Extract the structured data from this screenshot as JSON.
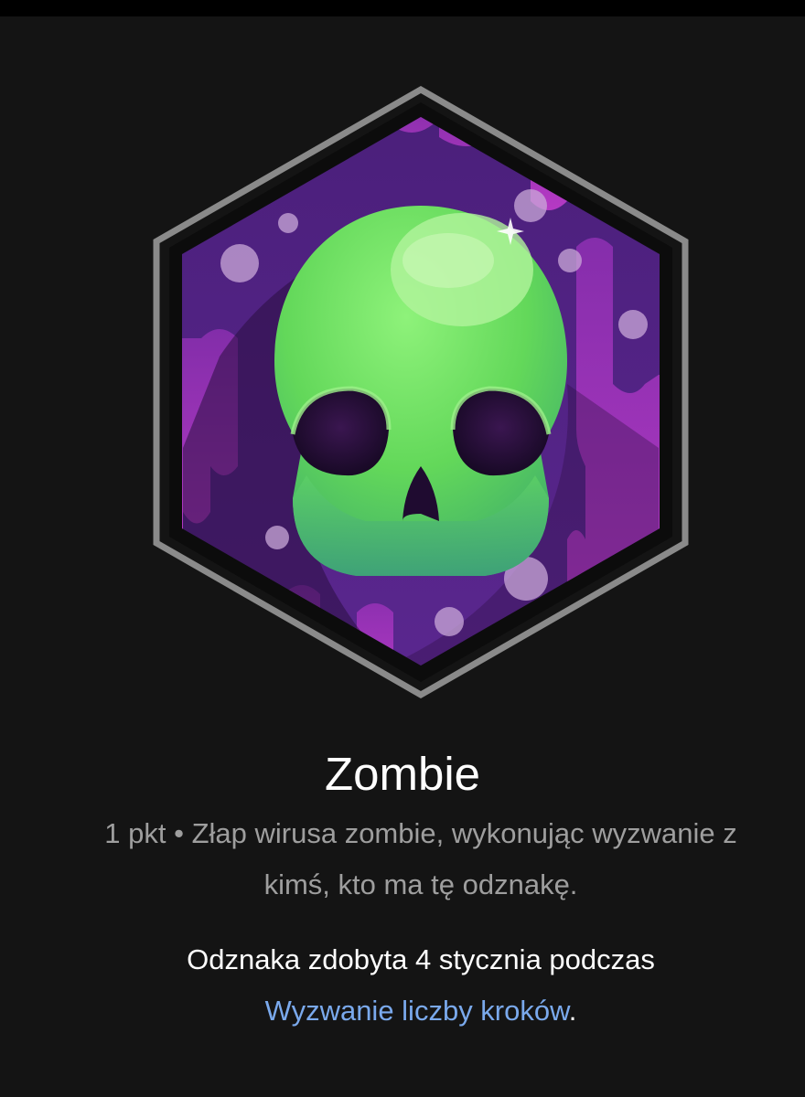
{
  "badge": {
    "title": "Zombie",
    "description": "1 pkt • Złap wirusa zombie, wykonując wyzwanie z kimś, kto ma tę odznakę.",
    "earned_prefix": "Odznaka zdobyta 4 stycznia podczas",
    "earned_link": "Wyzwanie liczby kroków",
    "earned_suffix": ".",
    "icon": "skull-icon"
  },
  "colors": {
    "background": "#141414",
    "frame": "#8a8a8a",
    "hex_fill": "#5a2585",
    "accent_purple": "#b734c2",
    "skull_green": "#6fe65a",
    "link": "#7aa9ec",
    "secondary_text": "#9e9e9e"
  }
}
